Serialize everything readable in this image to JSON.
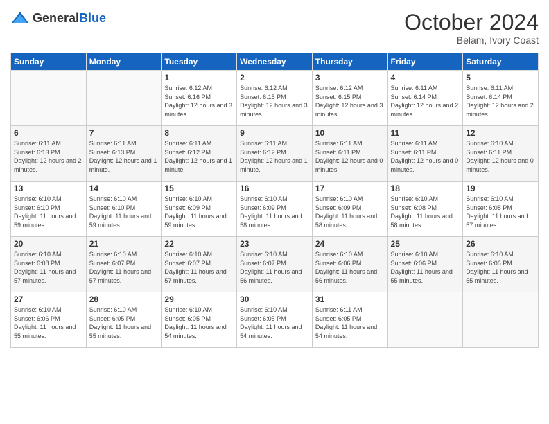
{
  "logo": {
    "general": "General",
    "blue": "Blue"
  },
  "header": {
    "month": "October 2024",
    "location": "Belam, Ivory Coast"
  },
  "weekdays": [
    "Sunday",
    "Monday",
    "Tuesday",
    "Wednesday",
    "Thursday",
    "Friday",
    "Saturday"
  ],
  "weeks": [
    [
      {
        "day": "",
        "info": ""
      },
      {
        "day": "",
        "info": ""
      },
      {
        "day": "1",
        "info": "Sunrise: 6:12 AM\nSunset: 6:16 PM\nDaylight: 12 hours and 3 minutes."
      },
      {
        "day": "2",
        "info": "Sunrise: 6:12 AM\nSunset: 6:15 PM\nDaylight: 12 hours and 3 minutes."
      },
      {
        "day": "3",
        "info": "Sunrise: 6:12 AM\nSunset: 6:15 PM\nDaylight: 12 hours and 3 minutes."
      },
      {
        "day": "4",
        "info": "Sunrise: 6:11 AM\nSunset: 6:14 PM\nDaylight: 12 hours and 2 minutes."
      },
      {
        "day": "5",
        "info": "Sunrise: 6:11 AM\nSunset: 6:14 PM\nDaylight: 12 hours and 2 minutes."
      }
    ],
    [
      {
        "day": "6",
        "info": "Sunrise: 6:11 AM\nSunset: 6:13 PM\nDaylight: 12 hours and 2 minutes."
      },
      {
        "day": "7",
        "info": "Sunrise: 6:11 AM\nSunset: 6:13 PM\nDaylight: 12 hours and 1 minute."
      },
      {
        "day": "8",
        "info": "Sunrise: 6:11 AM\nSunset: 6:12 PM\nDaylight: 12 hours and 1 minute."
      },
      {
        "day": "9",
        "info": "Sunrise: 6:11 AM\nSunset: 6:12 PM\nDaylight: 12 hours and 1 minute."
      },
      {
        "day": "10",
        "info": "Sunrise: 6:11 AM\nSunset: 6:11 PM\nDaylight: 12 hours and 0 minutes."
      },
      {
        "day": "11",
        "info": "Sunrise: 6:11 AM\nSunset: 6:11 PM\nDaylight: 12 hours and 0 minutes."
      },
      {
        "day": "12",
        "info": "Sunrise: 6:10 AM\nSunset: 6:11 PM\nDaylight: 12 hours and 0 minutes."
      }
    ],
    [
      {
        "day": "13",
        "info": "Sunrise: 6:10 AM\nSunset: 6:10 PM\nDaylight: 11 hours and 59 minutes."
      },
      {
        "day": "14",
        "info": "Sunrise: 6:10 AM\nSunset: 6:10 PM\nDaylight: 11 hours and 59 minutes."
      },
      {
        "day": "15",
        "info": "Sunrise: 6:10 AM\nSunset: 6:09 PM\nDaylight: 11 hours and 59 minutes."
      },
      {
        "day": "16",
        "info": "Sunrise: 6:10 AM\nSunset: 6:09 PM\nDaylight: 11 hours and 58 minutes."
      },
      {
        "day": "17",
        "info": "Sunrise: 6:10 AM\nSunset: 6:09 PM\nDaylight: 11 hours and 58 minutes."
      },
      {
        "day": "18",
        "info": "Sunrise: 6:10 AM\nSunset: 6:08 PM\nDaylight: 11 hours and 58 minutes."
      },
      {
        "day": "19",
        "info": "Sunrise: 6:10 AM\nSunset: 6:08 PM\nDaylight: 11 hours and 57 minutes."
      }
    ],
    [
      {
        "day": "20",
        "info": "Sunrise: 6:10 AM\nSunset: 6:08 PM\nDaylight: 11 hours and 57 minutes."
      },
      {
        "day": "21",
        "info": "Sunrise: 6:10 AM\nSunset: 6:07 PM\nDaylight: 11 hours and 57 minutes."
      },
      {
        "day": "22",
        "info": "Sunrise: 6:10 AM\nSunset: 6:07 PM\nDaylight: 11 hours and 57 minutes."
      },
      {
        "day": "23",
        "info": "Sunrise: 6:10 AM\nSunset: 6:07 PM\nDaylight: 11 hours and 56 minutes."
      },
      {
        "day": "24",
        "info": "Sunrise: 6:10 AM\nSunset: 6:06 PM\nDaylight: 11 hours and 56 minutes."
      },
      {
        "day": "25",
        "info": "Sunrise: 6:10 AM\nSunset: 6:06 PM\nDaylight: 11 hours and 55 minutes."
      },
      {
        "day": "26",
        "info": "Sunrise: 6:10 AM\nSunset: 6:06 PM\nDaylight: 11 hours and 55 minutes."
      }
    ],
    [
      {
        "day": "27",
        "info": "Sunrise: 6:10 AM\nSunset: 6:06 PM\nDaylight: 11 hours and 55 minutes."
      },
      {
        "day": "28",
        "info": "Sunrise: 6:10 AM\nSunset: 6:05 PM\nDaylight: 11 hours and 55 minutes."
      },
      {
        "day": "29",
        "info": "Sunrise: 6:10 AM\nSunset: 6:05 PM\nDaylight: 11 hours and 54 minutes."
      },
      {
        "day": "30",
        "info": "Sunrise: 6:10 AM\nSunset: 6:05 PM\nDaylight: 11 hours and 54 minutes."
      },
      {
        "day": "31",
        "info": "Sunrise: 6:11 AM\nSunset: 6:05 PM\nDaylight: 11 hours and 54 minutes."
      },
      {
        "day": "",
        "info": ""
      },
      {
        "day": "",
        "info": ""
      }
    ]
  ]
}
